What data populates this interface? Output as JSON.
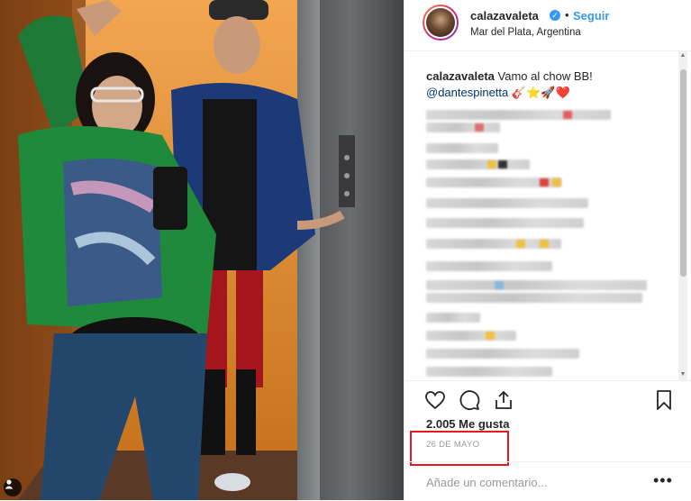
{
  "post": {
    "username": "calazavaleta",
    "verified_icon": "verified-badge-icon",
    "separator": "•",
    "follow_label": "Seguir",
    "location": "Mar del Plata, Argentina"
  },
  "caption": {
    "username": "calazavaleta",
    "text": "Vamo al chow BB!",
    "mention": "@dantespinetta",
    "emoji": "🎸⭐🚀❤️"
  },
  "actions": {
    "like_icon": "heart-icon",
    "comment_icon": "comment-bubble-icon",
    "share_icon": "share-icon",
    "save_icon": "bookmark-icon"
  },
  "likes_text": "2.005 Me gusta",
  "date_text": "26 DE MAYO",
  "comment_box": {
    "placeholder": "Añade un comentario...",
    "more_label": "•••"
  },
  "colors": {
    "accent": "#3897f0",
    "highlight": "#e8191e",
    "text": "#262626"
  }
}
